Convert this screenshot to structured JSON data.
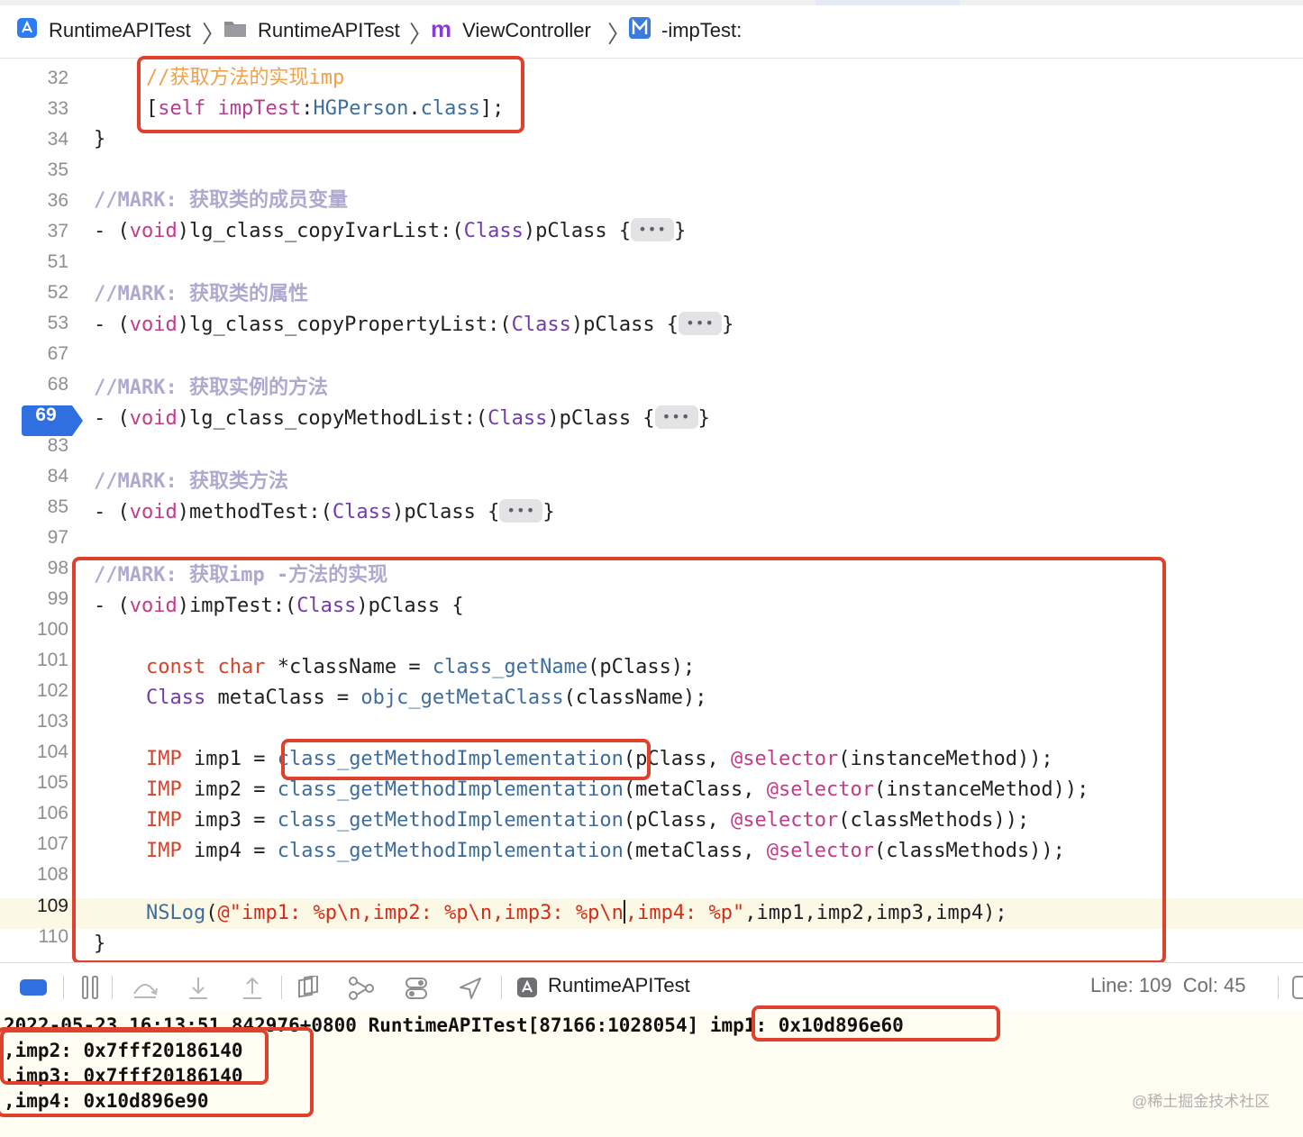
{
  "breadcrumb": {
    "items": [
      {
        "label": "RuntimeAPITest",
        "icon": "app-project-icon"
      },
      {
        "label": "RuntimeAPITest",
        "icon": "folder-icon"
      },
      {
        "label": "ViewController",
        "icon": "m-file-icon"
      },
      {
        "label": "-impTest:",
        "icon": "method-icon"
      }
    ]
  },
  "editor": {
    "current_line": "109",
    "breakpoint_line": "69",
    "fold_placeholder": "•••",
    "lines": [
      {
        "n": "32",
        "code": "//获取方法的实现imp"
      },
      {
        "n": "33",
        "code": "[self impTest:HGPerson.class];"
      },
      {
        "n": "34",
        "code": "}"
      },
      {
        "n": "35",
        "code": ""
      },
      {
        "n": "36",
        "code": "//MARK: 获取类的成员变量"
      },
      {
        "n": "37",
        "code": "- (void)lg_class_copyIvarList:(Class)pClass {•••}"
      },
      {
        "n": "51",
        "code": ""
      },
      {
        "n": "52",
        "code": "//MARK: 获取类的属性"
      },
      {
        "n": "53",
        "code": "- (void)lg_class_copyPropertyList:(Class)pClass {•••}"
      },
      {
        "n": "67",
        "code": ""
      },
      {
        "n": "68",
        "code": "//MARK: 获取实例的方法"
      },
      {
        "n": "69",
        "code": "- (void)lg_class_copyMethodList:(Class)pClass {•••}"
      },
      {
        "n": "83",
        "code": ""
      },
      {
        "n": "84",
        "code": "//MARK: 获取类方法"
      },
      {
        "n": "85",
        "code": "- (void)methodTest:(Class)pClass {•••}"
      },
      {
        "n": "97",
        "code": ""
      },
      {
        "n": "98",
        "code": "//MARK: 获取imp -方法的实现"
      },
      {
        "n": "99",
        "code": "- (void)impTest:(Class)pClass {"
      },
      {
        "n": "100",
        "code": ""
      },
      {
        "n": "101",
        "code": "const char *className = class_getName(pClass);"
      },
      {
        "n": "102",
        "code": "Class metaClass = objc_getMetaClass(className);"
      },
      {
        "n": "103",
        "code": ""
      },
      {
        "n": "104",
        "code": "IMP imp1 = class_getMethodImplementation(pClass, @selector(instanceMethod));"
      },
      {
        "n": "105",
        "code": "IMP imp2 = class_getMethodImplementation(metaClass, @selector(instanceMethod));"
      },
      {
        "n": "106",
        "code": "IMP imp3 = class_getMethodImplementation(pClass, @selector(classMethods));"
      },
      {
        "n": "107",
        "code": "IMP imp4 = class_getMethodImplementation(metaClass, @selector(classMethods));"
      },
      {
        "n": "108",
        "code": ""
      },
      {
        "n": "109",
        "code": "NSLog(@\"imp1: %p\\n,imp2: %p\\n,imp3: %p\\n,imp4: %p\",imp1,imp2,imp3,imp4);"
      },
      {
        "n": "110",
        "code": "}"
      }
    ]
  },
  "debug_bar": {
    "target": "RuntimeAPITest",
    "line_col": "Line: 109  Col: 45"
  },
  "console": {
    "lines": [
      "2022-05-23 16:13:51.842976+0800 RuntimeAPITest[87166:1028054] imp1: 0x10d896e60",
      ",imp2: 0x7fff20186140",
      ",imp3: 0x7fff20186140",
      ",imp4: 0x10d896e90"
    ]
  },
  "watermark": "@稀土掘金技术社区",
  "colors": {
    "keyword": "#c23b86",
    "function": "#3e6d9c",
    "class": "#703daa",
    "comment": "#f0a14a",
    "mark": "#b1a8cf",
    "annotation_box": "#e0412d",
    "breakpoint": "#2f6fe0",
    "current_line": "#fcf8e6",
    "console_bg": "#fffdf2"
  }
}
